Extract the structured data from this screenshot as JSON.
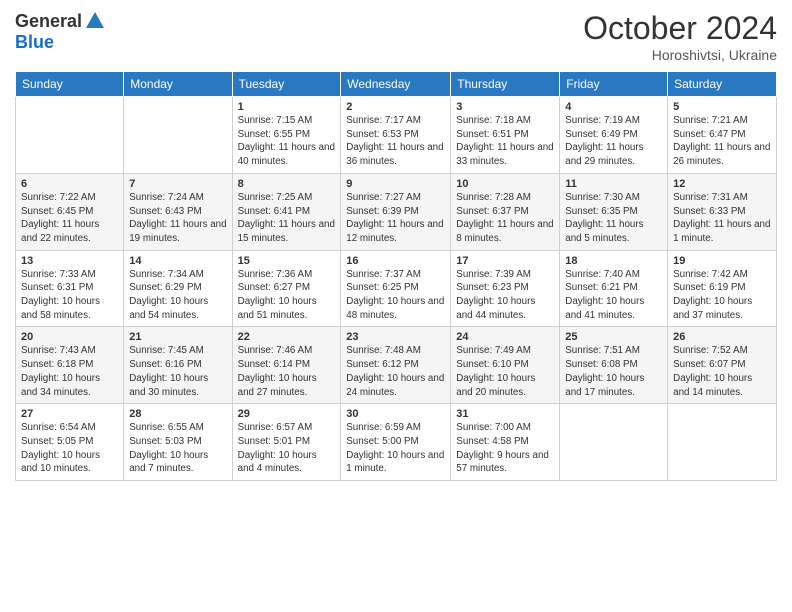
{
  "header": {
    "logo_general": "General",
    "logo_blue": "Blue",
    "month_title": "October 2024",
    "location": "Horoshivtsi, Ukraine"
  },
  "days_of_week": [
    "Sunday",
    "Monday",
    "Tuesday",
    "Wednesday",
    "Thursday",
    "Friday",
    "Saturday"
  ],
  "weeks": [
    [
      {
        "day": "",
        "sunrise": "",
        "sunset": "",
        "daylight": ""
      },
      {
        "day": "",
        "sunrise": "",
        "sunset": "",
        "daylight": ""
      },
      {
        "day": "1",
        "sunrise": "Sunrise: 7:15 AM",
        "sunset": "Sunset: 6:55 PM",
        "daylight": "Daylight: 11 hours and 40 minutes."
      },
      {
        "day": "2",
        "sunrise": "Sunrise: 7:17 AM",
        "sunset": "Sunset: 6:53 PM",
        "daylight": "Daylight: 11 hours and 36 minutes."
      },
      {
        "day": "3",
        "sunrise": "Sunrise: 7:18 AM",
        "sunset": "Sunset: 6:51 PM",
        "daylight": "Daylight: 11 hours and 33 minutes."
      },
      {
        "day": "4",
        "sunrise": "Sunrise: 7:19 AM",
        "sunset": "Sunset: 6:49 PM",
        "daylight": "Daylight: 11 hours and 29 minutes."
      },
      {
        "day": "5",
        "sunrise": "Sunrise: 7:21 AM",
        "sunset": "Sunset: 6:47 PM",
        "daylight": "Daylight: 11 hours and 26 minutes."
      }
    ],
    [
      {
        "day": "6",
        "sunrise": "Sunrise: 7:22 AM",
        "sunset": "Sunset: 6:45 PM",
        "daylight": "Daylight: 11 hours and 22 minutes."
      },
      {
        "day": "7",
        "sunrise": "Sunrise: 7:24 AM",
        "sunset": "Sunset: 6:43 PM",
        "daylight": "Daylight: 11 hours and 19 minutes."
      },
      {
        "day": "8",
        "sunrise": "Sunrise: 7:25 AM",
        "sunset": "Sunset: 6:41 PM",
        "daylight": "Daylight: 11 hours and 15 minutes."
      },
      {
        "day": "9",
        "sunrise": "Sunrise: 7:27 AM",
        "sunset": "Sunset: 6:39 PM",
        "daylight": "Daylight: 11 hours and 12 minutes."
      },
      {
        "day": "10",
        "sunrise": "Sunrise: 7:28 AM",
        "sunset": "Sunset: 6:37 PM",
        "daylight": "Daylight: 11 hours and 8 minutes."
      },
      {
        "day": "11",
        "sunrise": "Sunrise: 7:30 AM",
        "sunset": "Sunset: 6:35 PM",
        "daylight": "Daylight: 11 hours and 5 minutes."
      },
      {
        "day": "12",
        "sunrise": "Sunrise: 7:31 AM",
        "sunset": "Sunset: 6:33 PM",
        "daylight": "Daylight: 11 hours and 1 minute."
      }
    ],
    [
      {
        "day": "13",
        "sunrise": "Sunrise: 7:33 AM",
        "sunset": "Sunset: 6:31 PM",
        "daylight": "Daylight: 10 hours and 58 minutes."
      },
      {
        "day": "14",
        "sunrise": "Sunrise: 7:34 AM",
        "sunset": "Sunset: 6:29 PM",
        "daylight": "Daylight: 10 hours and 54 minutes."
      },
      {
        "day": "15",
        "sunrise": "Sunrise: 7:36 AM",
        "sunset": "Sunset: 6:27 PM",
        "daylight": "Daylight: 10 hours and 51 minutes."
      },
      {
        "day": "16",
        "sunrise": "Sunrise: 7:37 AM",
        "sunset": "Sunset: 6:25 PM",
        "daylight": "Daylight: 10 hours and 48 minutes."
      },
      {
        "day": "17",
        "sunrise": "Sunrise: 7:39 AM",
        "sunset": "Sunset: 6:23 PM",
        "daylight": "Daylight: 10 hours and 44 minutes."
      },
      {
        "day": "18",
        "sunrise": "Sunrise: 7:40 AM",
        "sunset": "Sunset: 6:21 PM",
        "daylight": "Daylight: 10 hours and 41 minutes."
      },
      {
        "day": "19",
        "sunrise": "Sunrise: 7:42 AM",
        "sunset": "Sunset: 6:19 PM",
        "daylight": "Daylight: 10 hours and 37 minutes."
      }
    ],
    [
      {
        "day": "20",
        "sunrise": "Sunrise: 7:43 AM",
        "sunset": "Sunset: 6:18 PM",
        "daylight": "Daylight: 10 hours and 34 minutes."
      },
      {
        "day": "21",
        "sunrise": "Sunrise: 7:45 AM",
        "sunset": "Sunset: 6:16 PM",
        "daylight": "Daylight: 10 hours and 30 minutes."
      },
      {
        "day": "22",
        "sunrise": "Sunrise: 7:46 AM",
        "sunset": "Sunset: 6:14 PM",
        "daylight": "Daylight: 10 hours and 27 minutes."
      },
      {
        "day": "23",
        "sunrise": "Sunrise: 7:48 AM",
        "sunset": "Sunset: 6:12 PM",
        "daylight": "Daylight: 10 hours and 24 minutes."
      },
      {
        "day": "24",
        "sunrise": "Sunrise: 7:49 AM",
        "sunset": "Sunset: 6:10 PM",
        "daylight": "Daylight: 10 hours and 20 minutes."
      },
      {
        "day": "25",
        "sunrise": "Sunrise: 7:51 AM",
        "sunset": "Sunset: 6:08 PM",
        "daylight": "Daylight: 10 hours and 17 minutes."
      },
      {
        "day": "26",
        "sunrise": "Sunrise: 7:52 AM",
        "sunset": "Sunset: 6:07 PM",
        "daylight": "Daylight: 10 hours and 14 minutes."
      }
    ],
    [
      {
        "day": "27",
        "sunrise": "Sunrise: 6:54 AM",
        "sunset": "Sunset: 5:05 PM",
        "daylight": "Daylight: 10 hours and 10 minutes."
      },
      {
        "day": "28",
        "sunrise": "Sunrise: 6:55 AM",
        "sunset": "Sunset: 5:03 PM",
        "daylight": "Daylight: 10 hours and 7 minutes."
      },
      {
        "day": "29",
        "sunrise": "Sunrise: 6:57 AM",
        "sunset": "Sunset: 5:01 PM",
        "daylight": "Daylight: 10 hours and 4 minutes."
      },
      {
        "day": "30",
        "sunrise": "Sunrise: 6:59 AM",
        "sunset": "Sunset: 5:00 PM",
        "daylight": "Daylight: 10 hours and 1 minute."
      },
      {
        "day": "31",
        "sunrise": "Sunrise: 7:00 AM",
        "sunset": "Sunset: 4:58 PM",
        "daylight": "Daylight: 9 hours and 57 minutes."
      },
      {
        "day": "",
        "sunrise": "",
        "sunset": "",
        "daylight": ""
      },
      {
        "day": "",
        "sunrise": "",
        "sunset": "",
        "daylight": ""
      }
    ]
  ]
}
